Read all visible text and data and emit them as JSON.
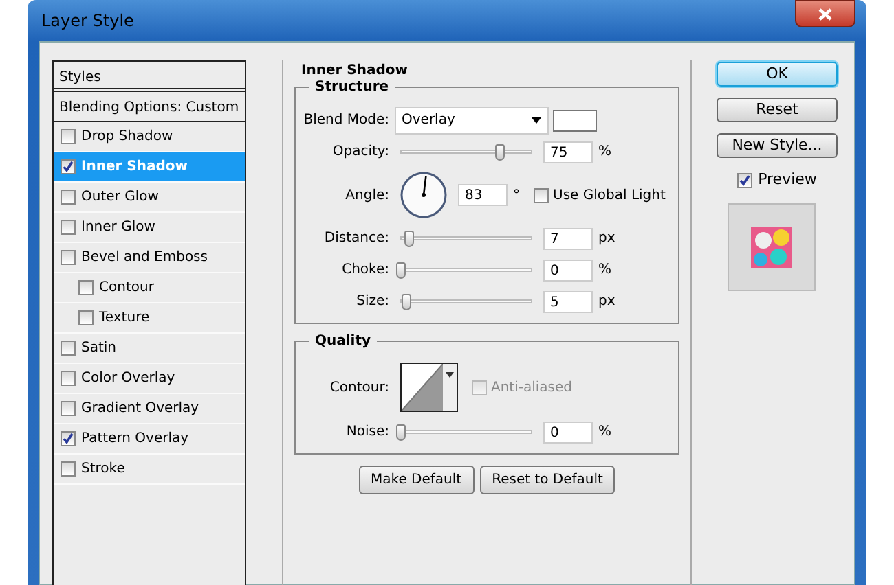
{
  "window": {
    "title": "Layer Style"
  },
  "styles": {
    "header": "Styles",
    "blending": "Blending Options: Custom",
    "items": [
      {
        "label": "Drop Shadow",
        "checked": false,
        "selected": false
      },
      {
        "label": "Inner Shadow",
        "checked": true,
        "selected": true
      },
      {
        "label": "Outer Glow",
        "checked": false,
        "selected": false
      },
      {
        "label": "Inner Glow",
        "checked": false,
        "selected": false
      },
      {
        "label": "Bevel and Emboss",
        "checked": false,
        "selected": false,
        "children": [
          {
            "label": "Contour",
            "checked": false,
            "selected": false
          },
          {
            "label": "Texture",
            "checked": false,
            "selected": false
          }
        ]
      },
      {
        "label": "Satin",
        "checked": false,
        "selected": false
      },
      {
        "label": "Color Overlay",
        "checked": false,
        "selected": false
      },
      {
        "label": "Gradient Overlay",
        "checked": false,
        "selected": false
      },
      {
        "label": "Pattern Overlay",
        "checked": true,
        "selected": false
      },
      {
        "label": "Stroke",
        "checked": false,
        "selected": false
      }
    ]
  },
  "panel": {
    "title": "Inner Shadow",
    "structure": {
      "title": "Structure",
      "rows": [
        {
          "kind": "blend",
          "label": "Blend Mode:",
          "value": "Overlay"
        },
        {
          "kind": "slider",
          "label": "Opacity:",
          "level": 0.75,
          "value": "75",
          "unit": "%"
        },
        {
          "kind": "angle",
          "label": "Angle:",
          "value": "83",
          "unit": "°",
          "checkbox": {
            "label": "Use Global Light",
            "checked": false
          }
        },
        {
          "kind": "slider",
          "label": "Distance:",
          "level": 0.06,
          "value": "7",
          "unit": "px"
        },
        {
          "kind": "slider",
          "label": "Choke:",
          "level": 0,
          "value": "0",
          "unit": "%"
        },
        {
          "kind": "slider",
          "label": "Size:",
          "level": 0.04,
          "value": "5",
          "unit": "px"
        }
      ]
    },
    "quality": {
      "title": "Quality",
      "rows": [
        {
          "kind": "contour",
          "label": "Contour:",
          "checkbox": {
            "label": "Anti-aliased",
            "checked": false,
            "disabled": true
          }
        },
        {
          "kind": "slider",
          "label": "Noise:",
          "level": 0,
          "value": "0",
          "unit": "%"
        }
      ]
    },
    "buttons": [
      "Make Default",
      "Reset to Default"
    ]
  },
  "actions": [
    {
      "label": "OK",
      "default": true
    },
    {
      "label": "Reset",
      "default": false
    },
    {
      "label": "New Style...",
      "default": false
    }
  ],
  "preview": {
    "label": "Preview",
    "checked": true
  }
}
